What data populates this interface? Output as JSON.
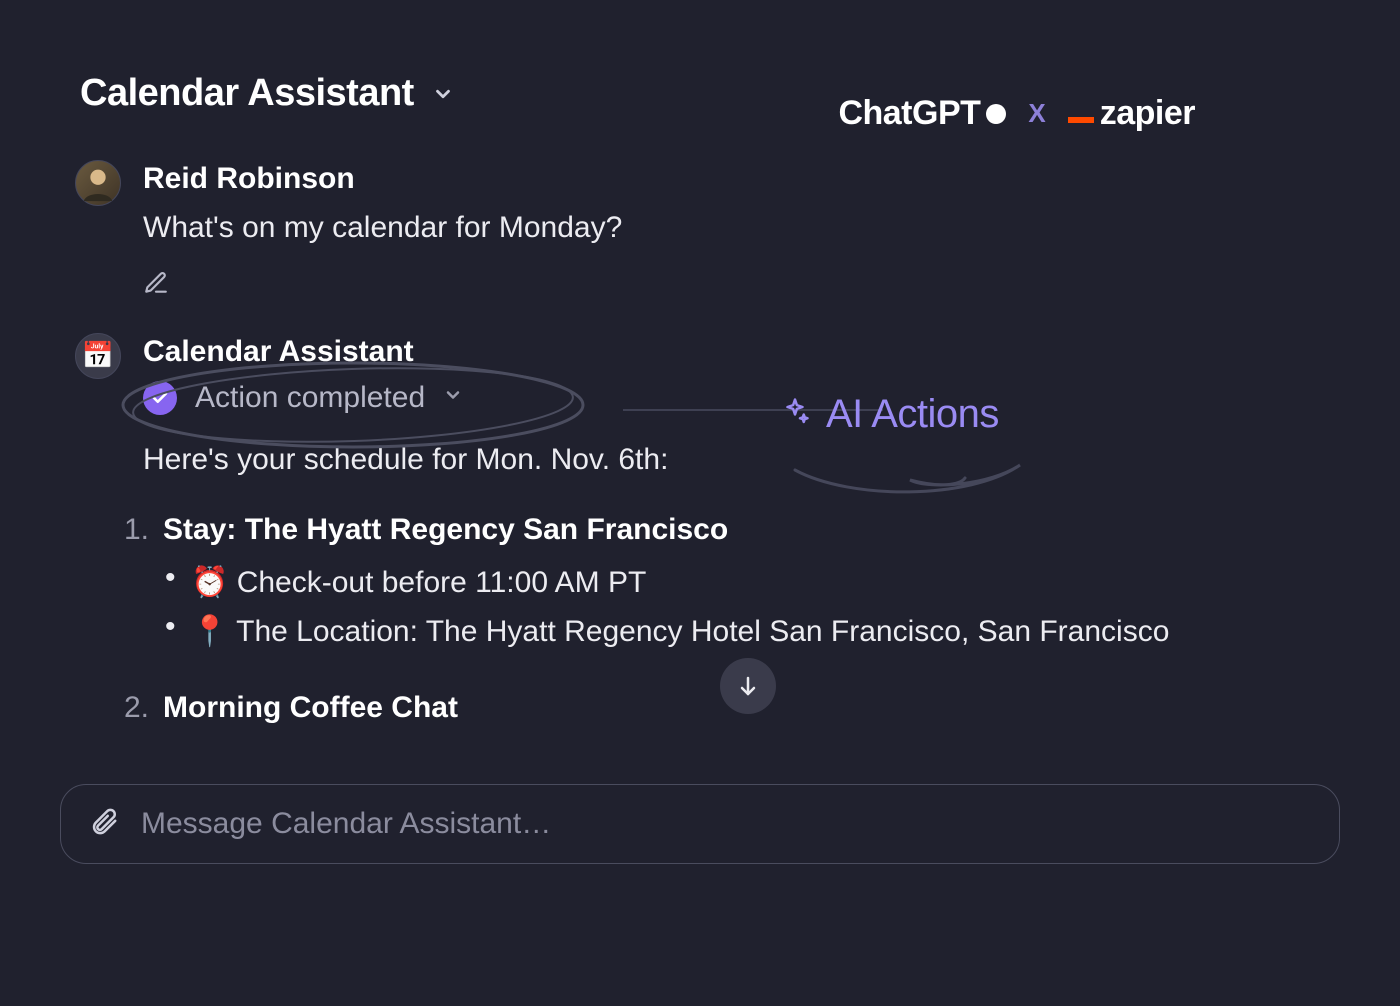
{
  "header": {
    "title": "Calendar Assistant"
  },
  "branding": {
    "left": "ChatGPT",
    "separator": "X",
    "right": "zapier"
  },
  "callout": {
    "label": "AI Actions"
  },
  "conversation": {
    "user": {
      "name": "Reid Robinson",
      "text": "What's on my calendar for Monday?"
    },
    "assistant": {
      "name": "Calendar Assistant",
      "action_status": "Action completed",
      "intro": "Here's your schedule for Mon. Nov. 6th:",
      "items": [
        {
          "num": "1.",
          "title": "Stay: The Hyatt Regency San Francisco",
          "details": [
            "⏰ Check-out before 11:00 AM PT",
            "📍 The Location: The Hyatt Regency Hotel San Francisco, San Francisco"
          ]
        },
        {
          "num": "2.",
          "title": "Morning Coffee Chat",
          "details": []
        }
      ]
    }
  },
  "composer": {
    "placeholder": "Message Calendar Assistant…"
  }
}
